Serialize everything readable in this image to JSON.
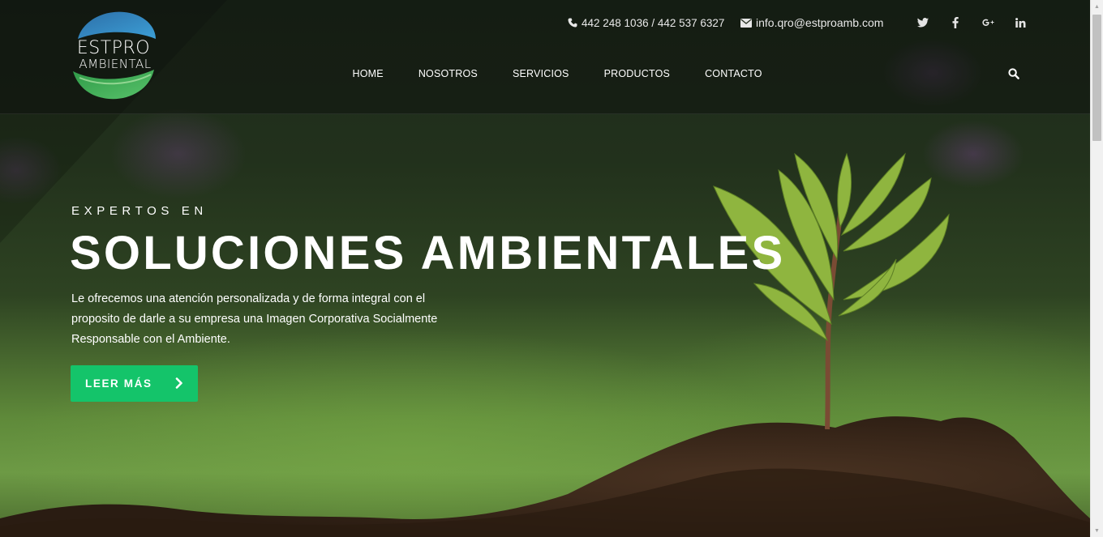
{
  "brand": {
    "logo_line1": "ESTPRO",
    "logo_line2": "AMBIENTAL",
    "logo_colors": {
      "top": "#2f7fb8",
      "bottom": "#3fae53"
    }
  },
  "contact": {
    "phone_icon": "phone-icon",
    "phone": "442 248 1036 / 442 537 6327",
    "email_icon": "envelope-icon",
    "email": "info.qro@estproamb.com"
  },
  "social": [
    {
      "icon": "twitter-icon",
      "glyph": "t"
    },
    {
      "icon": "facebook-icon",
      "glyph": "f"
    },
    {
      "icon": "google-plus-icon",
      "glyph": "g+"
    },
    {
      "icon": "linkedin-icon",
      "glyph": "in"
    }
  ],
  "nav": {
    "items": [
      {
        "label": "HOME"
      },
      {
        "label": "NOSOTROS"
      },
      {
        "label": "SERVICIOS"
      },
      {
        "label": "PRODUCTOS"
      },
      {
        "label": "CONTACTO"
      }
    ],
    "search_icon": "search-icon"
  },
  "hero": {
    "eyebrow": "EXPERTOS EN",
    "headline": "SOLUCIONES AMBIENTALES",
    "description": "Le ofrecemos una atención personalizada y de forma integral con el proposito de darle a su empresa una Imagen Corporativa Socialmente Responsable con el Ambiente.",
    "cta_label": "LEER MÁS",
    "cta_icon": "chevron-right-icon",
    "cta_color": "#14c46a"
  }
}
